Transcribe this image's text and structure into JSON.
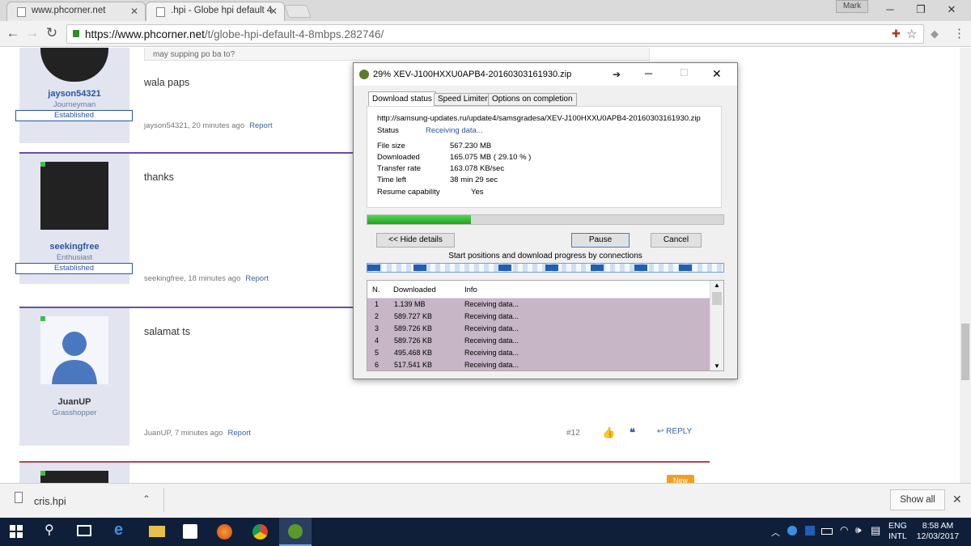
{
  "browser": {
    "tabs": [
      {
        "label": "www.phcorner.net"
      },
      {
        "label": ".hpi - Globe hpi default 4"
      }
    ],
    "user": "Mark",
    "url_host": "https://www.phcorner.net",
    "url_path": "/t/globe-hpi-default-4-8mbps.282746/"
  },
  "posts": [
    {
      "user": "jayson54321",
      "title": "Journeyman",
      "badge": "Established",
      "message": "wala paps",
      "meta": "jayson54321, 20 minutes ago",
      "report": "Report",
      "quote": "may supping po ba to?"
    },
    {
      "user": "seekingfree",
      "title": "Enthusiast",
      "badge": "Established",
      "message": "thanks",
      "meta": "seekingfree, 18 minutes ago",
      "report": "Report"
    },
    {
      "user": "JuanUP",
      "title": "Grasshopper",
      "message": "salamat ts",
      "meta": "JuanUP, 7 minutes ago",
      "report": "Report",
      "number": "#12",
      "reply": "REPLY"
    },
    {
      "badge_new": "New"
    }
  ],
  "downloads": {
    "file": "cris.hpi",
    "show_all": "Show all"
  },
  "taskbar": {
    "lang": "ENG",
    "layout": "INTL",
    "time": "8:58 AM",
    "date": "12/03/2017"
  },
  "idm": {
    "title": "29% XEV-J100HXXU0APB4-20160303161930.zip",
    "tabs": [
      "Download status",
      "Speed Limiter",
      "Options on completion"
    ],
    "url": "http://samsung-updates.ru/update4/samsgradesa/XEV-J100HXXU0APB4-20160303161930.zip",
    "status_label": "Status",
    "status_value": "Receiving data...",
    "fields": [
      {
        "label": "File size",
        "value": "567.230  MB"
      },
      {
        "label": "Downloaded",
        "value": "165.075  MB  ( 29.10 % )"
      },
      {
        "label": "Transfer rate",
        "value": "163.078  KB/sec"
      },
      {
        "label": "Time left",
        "value": "38 min 29 sec"
      },
      {
        "label": "Resume capability",
        "value": "Yes"
      }
    ],
    "progress": 0.291,
    "buttons": {
      "hide": "<< Hide details",
      "pause": "Pause",
      "cancel": "Cancel"
    },
    "conn_label": "Start positions and download progress by connections",
    "columns": [
      "N.",
      "Downloaded",
      "Info"
    ],
    "connections": [
      {
        "n": "1",
        "downloaded": "1.139  MB",
        "info": "Receiving data..."
      },
      {
        "n": "2",
        "downloaded": "589.727  KB",
        "info": "Receiving data..."
      },
      {
        "n": "3",
        "downloaded": "589.726  KB",
        "info": "Receiving data..."
      },
      {
        "n": "4",
        "downloaded": "589.726  KB",
        "info": "Receiving data..."
      },
      {
        "n": "5",
        "downloaded": "495.468  KB",
        "info": "Receiving data..."
      },
      {
        "n": "6",
        "downloaded": "517.541  KB",
        "info": "Receiving data..."
      }
    ]
  }
}
